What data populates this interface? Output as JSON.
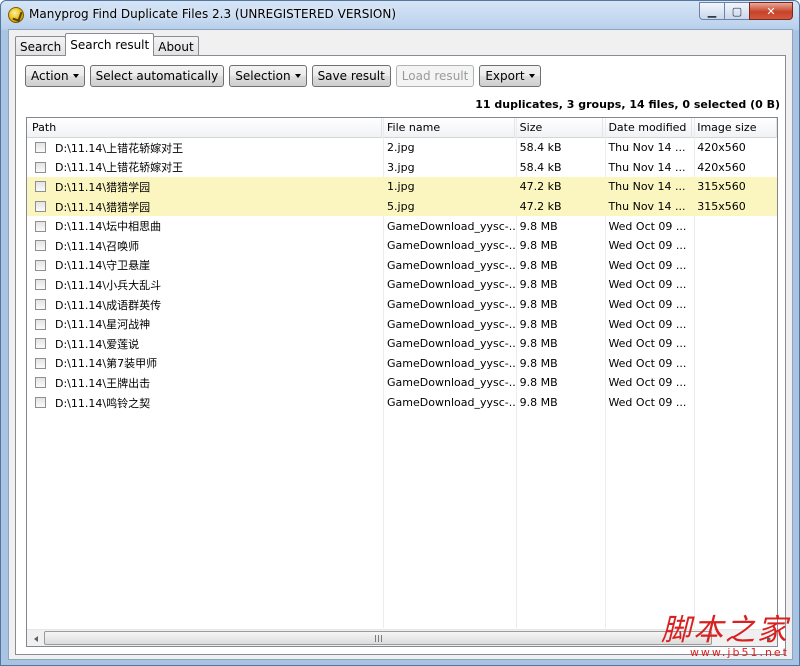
{
  "window": {
    "title": "Manyprog Find Duplicate Files 2.3 (UNREGISTERED VERSION)",
    "minimize_glyph": "▁",
    "maximize_glyph": "▢",
    "close_glyph": "✕"
  },
  "tabs": [
    {
      "label": "Search",
      "active": false
    },
    {
      "label": "Search result",
      "active": true
    },
    {
      "label": "About",
      "active": false
    }
  ],
  "toolbar": {
    "action_label": "Action",
    "select_auto_label": "Select automatically",
    "selection_label": "Selection",
    "save_label": "Save result",
    "load_label": "Load result",
    "export_label": "Export"
  },
  "summary": "11 duplicates, 3 groups, 14 files, 0 selected (0 B)",
  "columns": [
    "Path",
    "File name",
    "Size",
    "Date modified",
    "Image size"
  ],
  "rows": [
    {
      "path": "D:\\11.14\\上错花轿嫁对王",
      "name": "2.jpg",
      "size": "58.4 kB",
      "date": "Thu Nov 14 ...",
      "img": "420x560",
      "highlight": false
    },
    {
      "path": "D:\\11.14\\上错花轿嫁对王",
      "name": "3.jpg",
      "size": "58.4 kB",
      "date": "Thu Nov 14 ...",
      "img": "420x560",
      "highlight": false
    },
    {
      "path": "D:\\11.14\\猎猎学园",
      "name": "1.jpg",
      "size": "47.2 kB",
      "date": "Thu Nov 14 ...",
      "img": "315x560",
      "highlight": true
    },
    {
      "path": "D:\\11.14\\猎猎学园",
      "name": "5.jpg",
      "size": "47.2 kB",
      "date": "Thu Nov 14 ...",
      "img": "315x560",
      "highlight": true
    },
    {
      "path": "D:\\11.14\\坛中相思曲",
      "name": "GameDownload_yysc-...",
      "size": "9.8 MB",
      "date": "Wed Oct 09 ...",
      "img": "",
      "highlight": false
    },
    {
      "path": "D:\\11.14\\召唤师",
      "name": "GameDownload_yysc-...",
      "size": "9.8 MB",
      "date": "Wed Oct 09 ...",
      "img": "",
      "highlight": false
    },
    {
      "path": "D:\\11.14\\守卫悬崖",
      "name": "GameDownload_yysc-...",
      "size": "9.8 MB",
      "date": "Wed Oct 09 ...",
      "img": "",
      "highlight": false
    },
    {
      "path": "D:\\11.14\\小兵大乱斗",
      "name": "GameDownload_yysc-...",
      "size": "9.8 MB",
      "date": "Wed Oct 09 ...",
      "img": "",
      "highlight": false
    },
    {
      "path": "D:\\11.14\\成语群英传",
      "name": "GameDownload_yysc-...",
      "size": "9.8 MB",
      "date": "Wed Oct 09 ...",
      "img": "",
      "highlight": false
    },
    {
      "path": "D:\\11.14\\星河战神",
      "name": "GameDownload_yysc-...",
      "size": "9.8 MB",
      "date": "Wed Oct 09 ...",
      "img": "",
      "highlight": false
    },
    {
      "path": "D:\\11.14\\爱莲说",
      "name": "GameDownload_yysc-...",
      "size": "9.8 MB",
      "date": "Wed Oct 09 ...",
      "img": "",
      "highlight": false
    },
    {
      "path": "D:\\11.14\\第7装甲师",
      "name": "GameDownload_yysc-...",
      "size": "9.8 MB",
      "date": "Wed Oct 09 ...",
      "img": "",
      "highlight": false
    },
    {
      "path": "D:\\11.14\\王牌出击",
      "name": "GameDownload_yysc-...",
      "size": "9.8 MB",
      "date": "Wed Oct 09 ...",
      "img": "",
      "highlight": false
    },
    {
      "path": "D:\\11.14\\鸣铃之契",
      "name": "GameDownload_yysc-...",
      "size": "9.8 MB",
      "date": "Wed Oct 09 ...",
      "img": "",
      "highlight": false
    }
  ],
  "scrollbar": {
    "grip_glyph": "",
    "left_icon": "scroll-left-icon",
    "right_icon": "scroll-right-icon"
  },
  "watermark": {
    "main": "脚本之家",
    "url": "www.jb51.net",
    "color": "#d92020"
  },
  "colors": {
    "highlight_row": "#fbf6bf",
    "title_gradient_top": "#d6e5f6",
    "close_button": "#c7432a"
  }
}
